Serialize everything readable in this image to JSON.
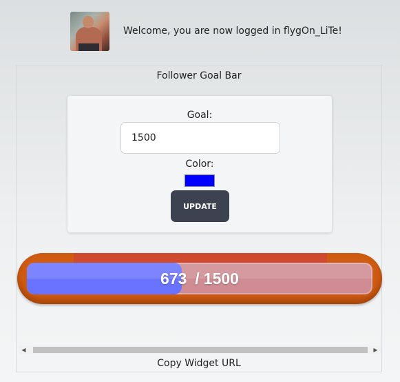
{
  "header": {
    "avatar_icon": "user-avatar-photo",
    "welcome_text": "Welcome, you are now logged in flygOn_LiTe!"
  },
  "widget_panel": {
    "title": "Follower Goal Bar",
    "form": {
      "goal_label": "Goal:",
      "goal_value": "1500",
      "color_label": "Color:",
      "color_value": "#0000ff",
      "update_label": "UPDATE"
    },
    "goal_bar": {
      "current": "673",
      "separator": "/",
      "goal": "1500",
      "progress_fraction": 0.4487,
      "fill_color": "#6a73ff",
      "track_color": "#cf8c93",
      "frame_color": "#d05c12"
    },
    "scrollbar": {
      "left_arrow_icon": "arrow-left-icon",
      "right_arrow_icon": "arrow-right-icon"
    },
    "copy_url_label": "Copy Widget URL"
  }
}
